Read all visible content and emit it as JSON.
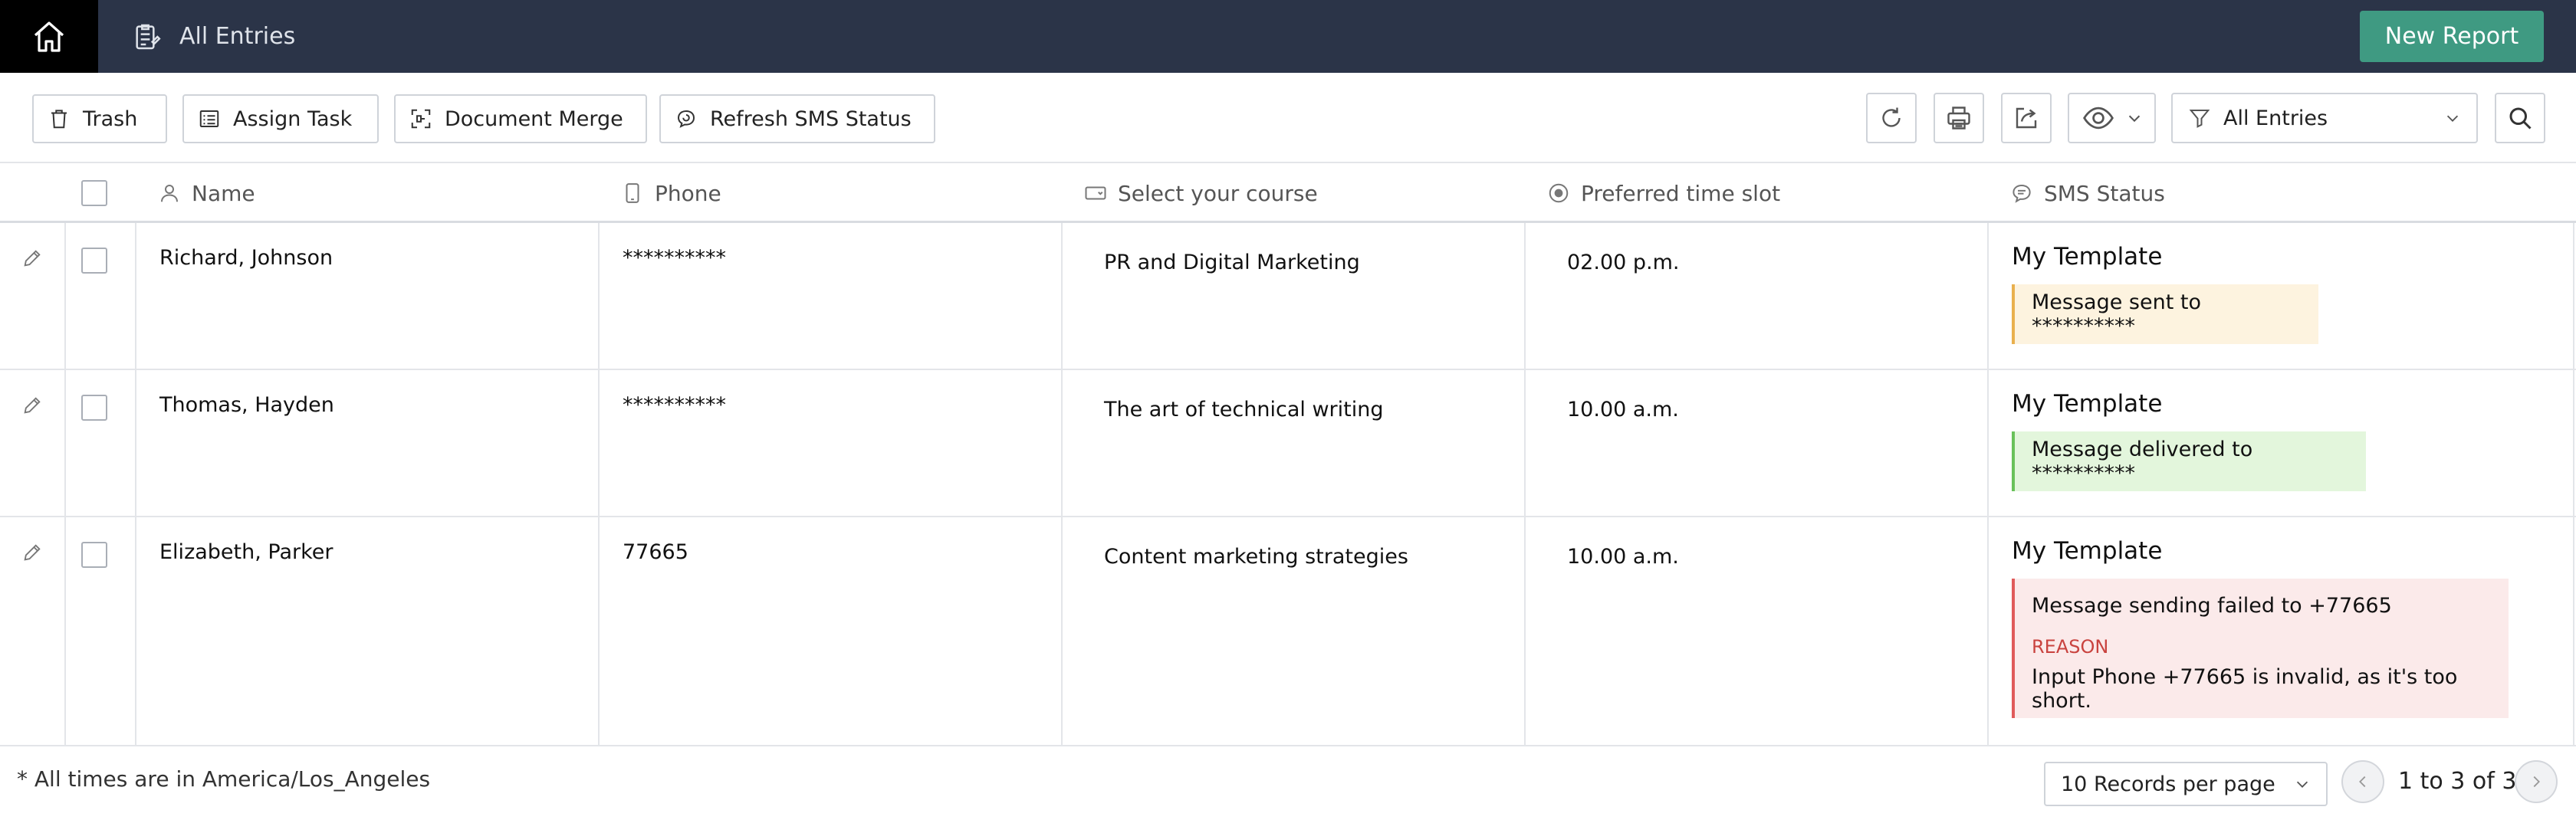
{
  "header": {
    "title": "All Entries",
    "new_report_label": "New Report"
  },
  "toolbar": {
    "trash_label": "Trash",
    "assign_task_label": "Assign Task",
    "document_merge_label": "Document Merge",
    "refresh_sms_label": "Refresh SMS Status",
    "filter_label": "All Entries"
  },
  "table": {
    "columns": [
      "Name",
      "Phone",
      "Select your course",
      "Preferred time slot",
      "SMS Status"
    ],
    "rows": [
      {
        "name": "Richard, Johnson",
        "phone": "**********",
        "course": "PR and Digital Marketing",
        "time": "02.00 p.m.",
        "sms_template": "My Template",
        "sms_message": "Message sent to **********",
        "sms_state": "sent"
      },
      {
        "name": "Thomas, Hayden",
        "phone": "**********",
        "course": "The art of technical writing",
        "time": "10.00 a.m.",
        "sms_template": "My Template",
        "sms_message": "Message delivered to **********",
        "sms_state": "delivered"
      },
      {
        "name": "Elizabeth, Parker",
        "phone": "77665",
        "course": "Content marketing strategies",
        "time": "10.00 a.m.",
        "sms_template": "My Template",
        "sms_message": "Message sending failed to +77665",
        "sms_reason_label": "REASON",
        "sms_reason": "Input Phone +77665 is invalid, as it's too short.",
        "sms_state": "failed"
      }
    ]
  },
  "footer": {
    "timezone_note": "* All times are in America/Los_Angeles",
    "records_per_page": "10 Records per page",
    "pagination_text": "1 to 3 of 3"
  },
  "colors": {
    "header_bg": "#2b3448",
    "home_bg": "#000000",
    "accent": "#3f9a82",
    "sent": "#e9b04e",
    "delivered": "#69c15a",
    "failed": "#e05b5b"
  }
}
